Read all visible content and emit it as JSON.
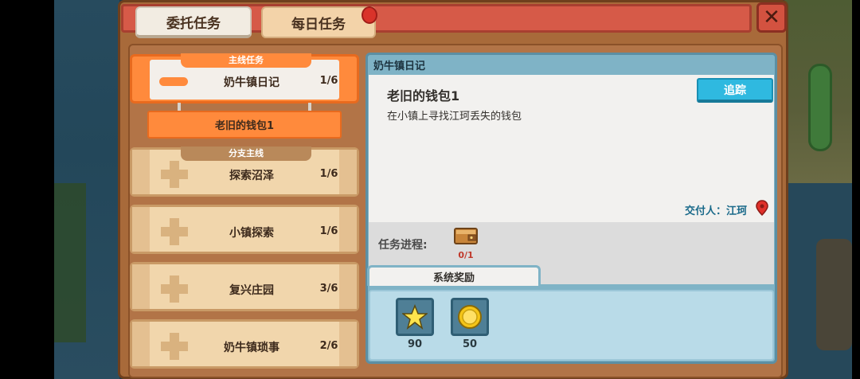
{
  "tabs": {
    "entrust": "委托任务",
    "daily": "每日任务"
  },
  "close_label": "✕",
  "quest_list": {
    "main_category": "主线任务",
    "branch_category": "分支主线",
    "items": [
      {
        "name": "奶牛镇日记",
        "progress": "1/6"
      },
      {
        "name": "探索沼泽",
        "progress": "1/6"
      },
      {
        "name": "小镇探索",
        "progress": "1/6"
      },
      {
        "name": "复兴庄园",
        "progress": "3/6"
      },
      {
        "name": "奶牛镇琐事",
        "progress": "2/6"
      }
    ],
    "selected_sub_quest": "老旧的钱包1"
  },
  "detail": {
    "header": "奶牛镇日记",
    "quest_title": "老旧的钱包1",
    "description": "在小镇上寻找江珂丢失的钱包",
    "track_button": "追踪",
    "giver": "交付人：江珂",
    "progress_label": "任务进程:",
    "progress_count": "0/1",
    "reward_tab": "系统奖励",
    "rewards": [
      {
        "icon": "star-icon",
        "amount": "90"
      },
      {
        "icon": "coin-icon",
        "amount": "50"
      }
    ]
  },
  "colors": {
    "accent_orange": "#ff8a3c",
    "track_blue": "#2fb9e0",
    "header_red": "#d65a48",
    "panel_blue": "#7fb3c6"
  }
}
